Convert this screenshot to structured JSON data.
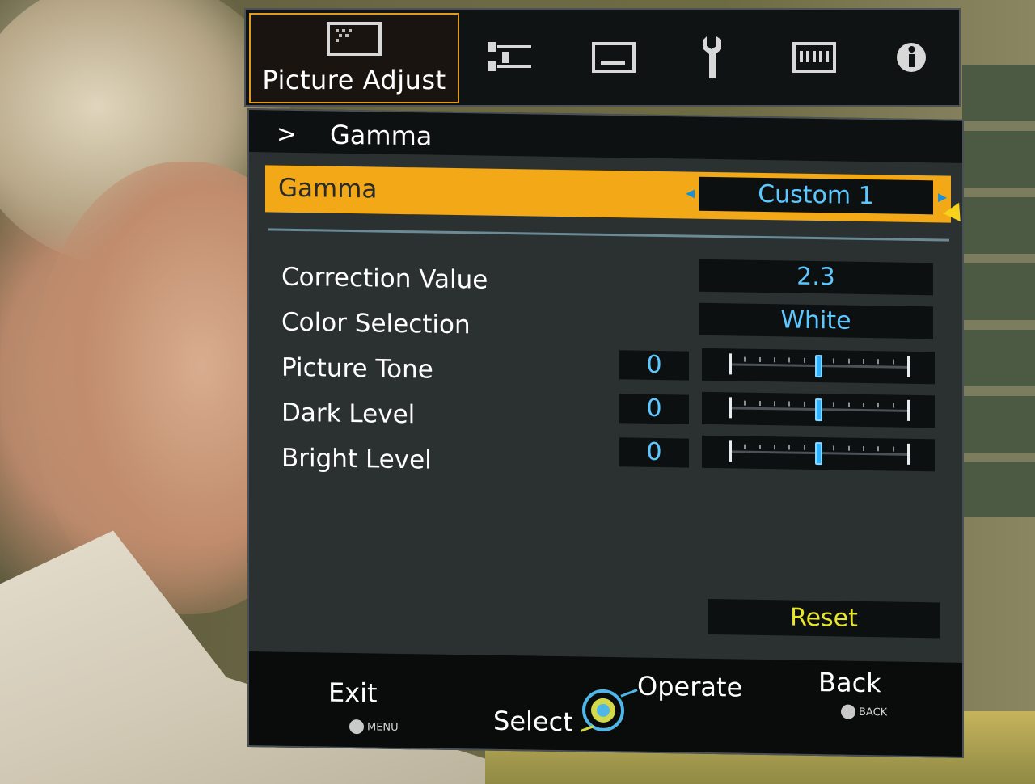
{
  "tabs": [
    {
      "icon": "picture-adjust-icon",
      "label": "Picture Adjust",
      "active": true
    },
    {
      "icon": "input-signal-icon"
    },
    {
      "icon": "display-icon"
    },
    {
      "icon": "wrench-icon"
    },
    {
      "icon": "keyboard-icon"
    },
    {
      "icon": "info-icon"
    }
  ],
  "breadcrumb": {
    "arrow": ">",
    "title": "Gamma"
  },
  "selected": {
    "label": "Gamma",
    "value": "Custom 1",
    "left_arrow": "◂",
    "right_arrow": "▸"
  },
  "settings": [
    {
      "label": "Correction Value",
      "value": "2.3"
    },
    {
      "label": "Color Selection",
      "value": "White"
    }
  ],
  "sliders": [
    {
      "label": "Picture Tone",
      "value": "0",
      "level": 0.5
    },
    {
      "label": "Dark Level",
      "value": "0",
      "level": 0.5
    },
    {
      "label": "Bright Level",
      "value": "0",
      "level": 0.5
    }
  ],
  "reset": "Reset",
  "footer": {
    "exit": "Exit",
    "exit_key": "MENU",
    "select": "Select",
    "operate": "Operate",
    "back": "Back",
    "back_key": "BACK"
  },
  "colors": {
    "highlight": "#f2a817",
    "value_text": "#5cc8ff",
    "reset_text": "#e8e628",
    "active_tab_border": "#e09a1c"
  }
}
